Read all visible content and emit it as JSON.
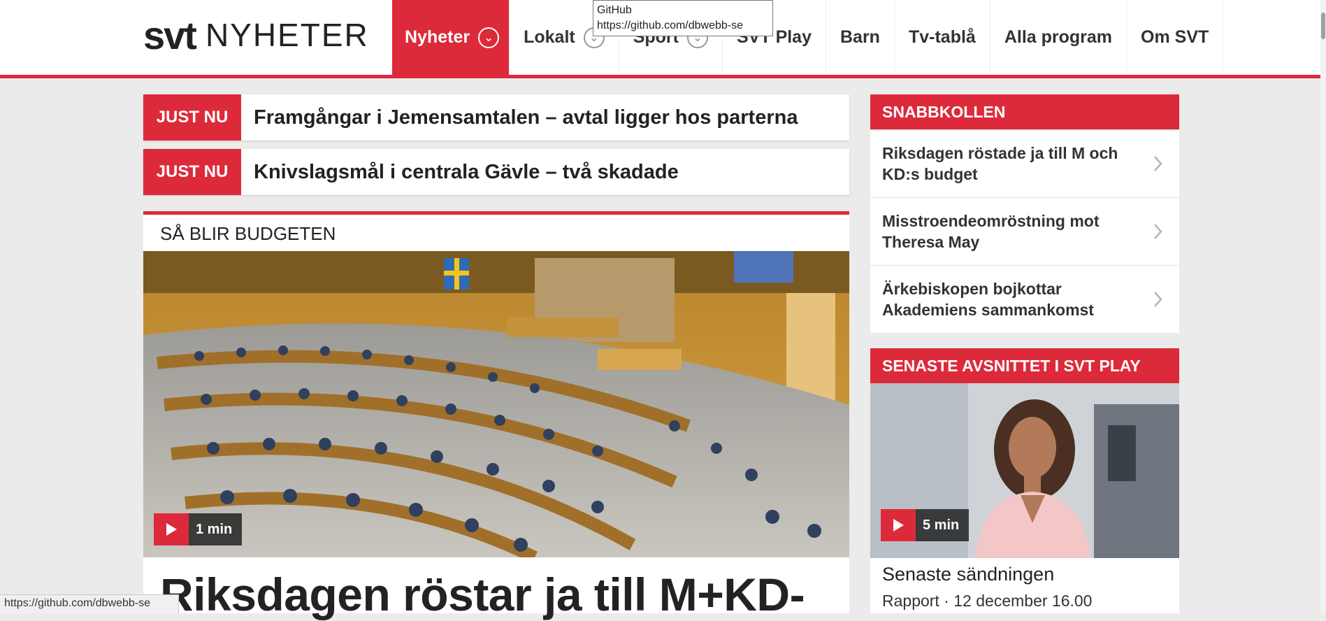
{
  "logo": {
    "brand": "svt",
    "section": "NYHETER"
  },
  "nav": {
    "items": [
      {
        "label": "Nyheter",
        "active": true,
        "dropdown": true
      },
      {
        "label": "Lokalt",
        "active": false,
        "dropdown": true
      },
      {
        "label": "Sport",
        "active": false,
        "dropdown": true
      },
      {
        "label": "SVT Play",
        "active": false,
        "dropdown": false
      },
      {
        "label": "Barn",
        "active": false,
        "dropdown": false
      },
      {
        "label": "Tv-tablå",
        "active": false,
        "dropdown": false
      },
      {
        "label": "Alla program",
        "active": false,
        "dropdown": false
      },
      {
        "label": "Om SVT",
        "active": false,
        "dropdown": false
      }
    ]
  },
  "tooltip": {
    "title": "GitHub",
    "url": "https://github.com/dbwebb-se"
  },
  "justnu": [
    {
      "badge": "JUST NU",
      "text": "Framgångar i Jemensamtalen – avtal ligger hos parterna"
    },
    {
      "badge": "JUST NU",
      "text": "Knivslagsmål i centrala Gävle – två skadade"
    }
  ],
  "feature": {
    "kicker": "SÅ BLIR BUDGETEN",
    "duration": "1 min",
    "headline": "Riksdagen röstar ja till M+KD-"
  },
  "snabbkollen": {
    "title": "SNABBKOLLEN",
    "items": [
      "Riksdagen röstade ja till M och KD:s budget",
      "Misstroendeomröstning mot Theresa May",
      "Ärkebiskopen bojkottar Akademiens sammankomst"
    ]
  },
  "svtplay": {
    "title": "SENASTE AVSNITTET I SVT PLAY",
    "duration": "5 min",
    "episode_title": "Senaste sändningen",
    "episode_meta": "Rapport · 12 december 16.00"
  },
  "statusbar": {
    "url": "https://github.com/dbwebb-se"
  },
  "colors": {
    "accent": "#dd2a3a",
    "page_bg": "#ebebeb"
  }
}
